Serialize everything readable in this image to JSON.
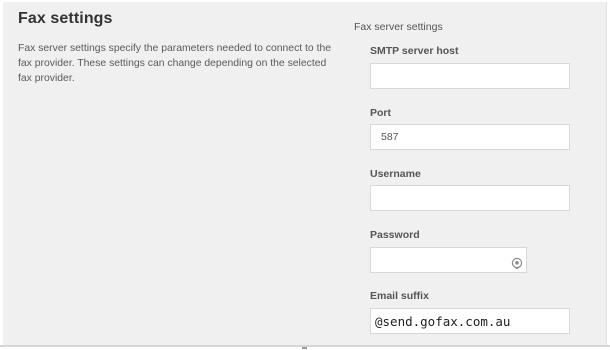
{
  "section": {
    "title": "Fax settings",
    "description": "Fax server settings specify the parameters needed to connect to the fax provider. These settings can change depending on the selected fax provider."
  },
  "fax_server": {
    "group_title": "Fax server settings",
    "smtp_host": {
      "label": "SMTP server host",
      "value": "",
      "placeholder": ""
    },
    "port": {
      "label": "Port",
      "value": "587"
    },
    "username": {
      "label": "Username",
      "value": ""
    },
    "password": {
      "label": "Password",
      "value": "",
      "reveal_icon": "eye-icon"
    },
    "email_suffix": {
      "label": "Email suffix",
      "value": "@send.gofax.com.au"
    }
  }
}
